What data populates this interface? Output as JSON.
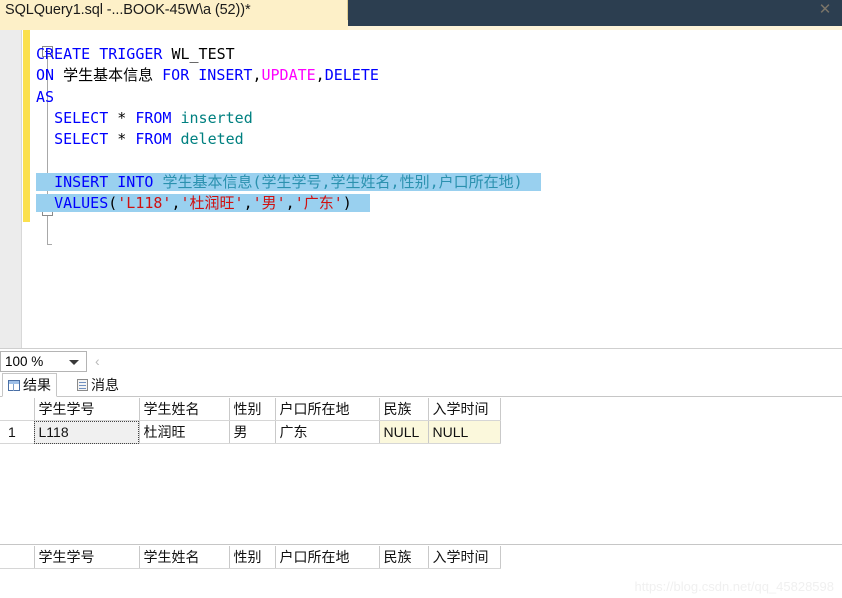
{
  "tab": {
    "title": "SQLQuery1.sql -...BOOK-45W\\a (52))*",
    "close_label": "✕"
  },
  "editor": {
    "lines": [
      {
        "id": "l1",
        "fold": true,
        "segments": [
          {
            "text": "CREATE",
            "style": "kw"
          },
          {
            "text": " ",
            "style": "punc"
          },
          {
            "text": "TRIGGER",
            "style": "kw"
          },
          {
            "text": " WL_TEST",
            "style": "punc"
          }
        ]
      },
      {
        "id": "l2",
        "fold": false,
        "segments": [
          {
            "text": "ON",
            "style": "kw"
          },
          {
            "text": " ",
            "style": "punc"
          },
          {
            "text": "学生基本信息",
            "style": "punc"
          },
          {
            "text": " ",
            "style": "punc"
          },
          {
            "text": "FOR",
            "style": "kw"
          },
          {
            "text": " ",
            "style": "punc"
          },
          {
            "text": "INSERT",
            "style": "kw"
          },
          {
            "text": ",",
            "style": "punc"
          },
          {
            "text": "UPDATE",
            "style": "kw2"
          },
          {
            "text": ",",
            "style": "punc"
          },
          {
            "text": "DELETE",
            "style": "kw"
          }
        ]
      },
      {
        "id": "l3",
        "fold": false,
        "segments": [
          {
            "text": "AS",
            "style": "kw"
          }
        ]
      },
      {
        "id": "l4",
        "fold": false,
        "segments": [
          {
            "text": "  ",
            "style": "punc"
          },
          {
            "text": "SELECT",
            "style": "kw"
          },
          {
            "text": " ",
            "style": "punc"
          },
          {
            "text": "*",
            "style": "punc"
          },
          {
            "text": " ",
            "style": "punc"
          },
          {
            "text": "FROM",
            "style": "kw"
          },
          {
            "text": " ",
            "style": "punc"
          },
          {
            "text": "inserted",
            "style": "idf"
          }
        ]
      },
      {
        "id": "l5",
        "fold": false,
        "segments": [
          {
            "text": "  ",
            "style": "punc"
          },
          {
            "text": "SELECT",
            "style": "kw"
          },
          {
            "text": " ",
            "style": "punc"
          },
          {
            "text": "*",
            "style": "punc"
          },
          {
            "text": " ",
            "style": "punc"
          },
          {
            "text": "FROM",
            "style": "kw"
          },
          {
            "text": " ",
            "style": "punc"
          },
          {
            "text": "deleted",
            "style": "idf"
          }
        ]
      },
      {
        "id": "l6",
        "fold": false,
        "segments": []
      },
      {
        "id": "l7",
        "fold": true,
        "selected": true,
        "segments": [
          {
            "text": "  ",
            "style": "punc"
          },
          {
            "text": "INSERT",
            "style": "kw"
          },
          {
            "text": " ",
            "style": "punc"
          },
          {
            "text": "INTO",
            "style": "kw"
          },
          {
            "text": " ",
            "style": "punc"
          },
          {
            "text": "学生基本信息",
            "style": "tbl"
          },
          {
            "text": "(",
            "style": "tbl"
          },
          {
            "text": "学生学号",
            "style": "tbl"
          },
          {
            "text": ",",
            "style": "tbl"
          },
          {
            "text": "学生姓名",
            "style": "tbl"
          },
          {
            "text": ",",
            "style": "tbl"
          },
          {
            "text": "性别",
            "style": "tbl"
          },
          {
            "text": ",",
            "style": "tbl"
          },
          {
            "text": "户口所在地",
            "style": "tbl"
          },
          {
            "text": ")",
            "style": "tbl"
          }
        ]
      },
      {
        "id": "l8",
        "fold": false,
        "selected": true,
        "segments": [
          {
            "text": "  ",
            "style": "punc"
          },
          {
            "text": "VALUES",
            "style": "kw"
          },
          {
            "text": "(",
            "style": "punc"
          },
          {
            "text": "'L118'",
            "style": "str"
          },
          {
            "text": ",",
            "style": "punc"
          },
          {
            "text": "'杜润旺'",
            "style": "str"
          },
          {
            "text": ",",
            "style": "punc"
          },
          {
            "text": "'男'",
            "style": "str"
          },
          {
            "text": ",",
            "style": "punc"
          },
          {
            "text": "'广东'",
            "style": "str"
          },
          {
            "text": ")",
            "style": "punc"
          }
        ]
      }
    ]
  },
  "zoombar": {
    "zoom_value": "100 %",
    "chevron": "‹"
  },
  "result_tabs": [
    {
      "id": "results",
      "label": "结果",
      "icon": "grid-icon",
      "active": true
    },
    {
      "id": "messages",
      "label": "消息",
      "icon": "message-icon",
      "active": false
    }
  ],
  "grids": [
    {
      "id": "grid-inserted",
      "columns": [
        "",
        "学生学号",
        "学生姓名",
        "性别",
        "户口所在地",
        "民族",
        "入学时间"
      ],
      "rows": [
        {
          "rownum": "1",
          "cells": [
            {
              "value": "L118",
              "state": "focused"
            },
            {
              "value": "杜润旺",
              "state": "normal"
            },
            {
              "value": "男",
              "state": "normal"
            },
            {
              "value": "广东",
              "state": "normal"
            },
            {
              "value": "NULL",
              "state": "null"
            },
            {
              "value": "NULL",
              "state": "null"
            }
          ]
        }
      ]
    },
    {
      "id": "grid-deleted",
      "columns": [
        "",
        "学生学号",
        "学生姓名",
        "性别",
        "户口所在地",
        "民族",
        "入学时间"
      ],
      "rows": []
    }
  ],
  "watermark": "https://blog.csdn.net/qq_45828598"
}
